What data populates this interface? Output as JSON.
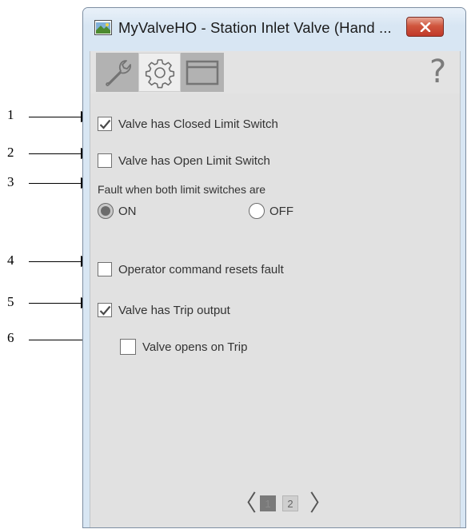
{
  "window": {
    "title": "MyValveHO - Station Inlet Valve (Hand ...",
    "close_icon": "close-icon"
  },
  "tabs": [
    {
      "name": "maintenance",
      "icon": "wrench-icon",
      "selected": false
    },
    {
      "name": "configuration",
      "icon": "gear-icon",
      "selected": true
    },
    {
      "name": "display",
      "icon": "window-icon",
      "selected": false
    }
  ],
  "help": {
    "glyph": "?",
    "icon": "help-icon"
  },
  "options": {
    "closed_limit": {
      "label": "Valve has Closed Limit Switch",
      "checked": true
    },
    "open_limit": {
      "label": "Valve has Open Limit Switch",
      "checked": false
    },
    "fault_label": "Fault when both limit switches are",
    "fault_on": {
      "label": "ON",
      "selected": true
    },
    "fault_off": {
      "label": "OFF",
      "selected": false
    },
    "operator_reset": {
      "label": "Operator command resets fault",
      "checked": false
    },
    "trip_output": {
      "label": "Valve has Trip output",
      "checked": true
    },
    "opens_on_trip": {
      "label": "Valve opens on Trip",
      "checked": false
    }
  },
  "pager": {
    "prev": "〈",
    "next": "〉",
    "pages": [
      "1",
      "2"
    ],
    "current": "1"
  },
  "callouts": [
    "1",
    "2",
    "3",
    "4",
    "5",
    "6"
  ],
  "colors": {
    "panel": "#e1e1e1",
    "window_frame": "#d8e6f3",
    "close_button": "#c74a35",
    "check": "#4a4a4a"
  }
}
